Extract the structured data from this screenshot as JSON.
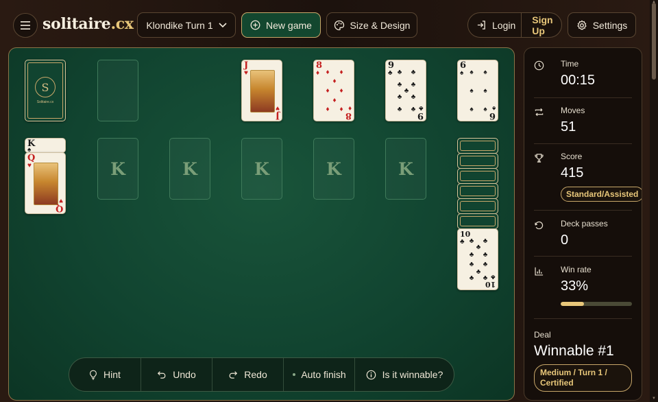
{
  "header": {
    "menu_icon": "hamburger-menu-icon",
    "logo_main": "solitaire",
    "logo_tld": ".cx",
    "variant_label": "Klondike Turn 1",
    "new_game_label": "New game",
    "design_label": "Size & Design",
    "login_label": "Login",
    "signup_label": "Sign Up",
    "settings_label": "Settings"
  },
  "board": {
    "stock_wordmark": "Solitaire.cx",
    "stock_emblem": "S",
    "foundations": [
      {
        "rank": "J",
        "suit": "♥",
        "color": "red"
      },
      {
        "rank": "8",
        "suit": "♦",
        "color": "red"
      },
      {
        "rank": "9",
        "suit": "♣",
        "color": "black"
      },
      {
        "rank": "6",
        "suit": "♠",
        "color": "black"
      }
    ],
    "tableau_column_1": [
      {
        "rank": "K",
        "suit": "♠",
        "color": "black"
      },
      {
        "rank": "Q",
        "suit": "♥",
        "color": "red"
      }
    ],
    "empty_slot_label": "K",
    "tableau_column_7_top": {
      "rank": "10",
      "suit": "♣",
      "color": "black"
    }
  },
  "toolbar": {
    "hint": "Hint",
    "undo": "Undo",
    "redo": "Redo",
    "auto_finish": "Auto finish",
    "winnable": "Is it winnable?"
  },
  "stats": {
    "time_label": "Time",
    "time_value": "00:15",
    "moves_label": "Moves",
    "moves_value": "51",
    "score_label": "Score",
    "score_value": "415",
    "score_mode": "Standard/Assisted",
    "passes_label": "Deck passes",
    "passes_value": "0",
    "winrate_label": "Win rate",
    "winrate_value": "33%",
    "winrate_fraction": 0.33,
    "deal_label": "Deal",
    "deal_value": "Winnable #1",
    "deal_meta": "Medium / Turn 1 / Certified"
  },
  "colors": {
    "felt": "#114430",
    "gold": "#e8c77a",
    "red_suit": "#c42020"
  }
}
